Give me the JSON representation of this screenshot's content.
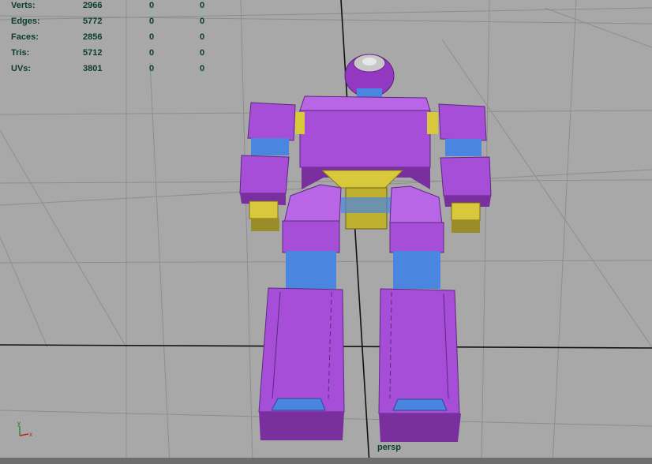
{
  "hud": {
    "rows": [
      {
        "label": "Verts:",
        "values": [
          "2966",
          "0",
          "0"
        ]
      },
      {
        "label": "Edges:",
        "values": [
          "5772",
          "0",
          "0"
        ]
      },
      {
        "label": "Faces:",
        "values": [
          "2856",
          "0",
          "0"
        ]
      },
      {
        "label": "Tris:",
        "values": [
          "5712",
          "0",
          "0"
        ]
      },
      {
        "label": "UVs:",
        "values": [
          "3801",
          "0",
          "0"
        ]
      }
    ]
  },
  "camera": "persp",
  "axis": {
    "y": "y",
    "x": "x"
  },
  "colors": {
    "background": "#a8a8a8",
    "grid": "#8c8c8c",
    "axis_line": "#111111",
    "magenta": "#a64ed8",
    "magenta_dark": "#7a2f9e",
    "blue": "#4a86e0",
    "yellow": "#d8c83c",
    "hud_text": "#0c3d2a"
  }
}
